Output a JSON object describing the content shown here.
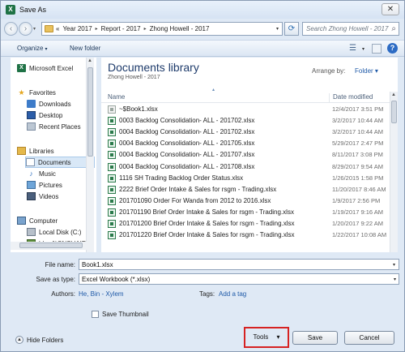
{
  "window": {
    "title": "Save As",
    "close_glyph": "✕"
  },
  "address": {
    "back_glyph": "‹",
    "forward_glyph": "›",
    "overflow": "«",
    "crumbs": [
      "Year 2017",
      "Report - 2017",
      "Zhong Howell - 2017"
    ],
    "separator": "▸",
    "dropdown_glyph": "▾",
    "refresh_glyph": "⟳"
  },
  "search": {
    "placeholder": "Search Zhong Howell - 2017",
    "icon": "search-icon"
  },
  "toolbar": {
    "organize_label": "Organize",
    "new_folder_label": "New folder",
    "help_glyph": "?"
  },
  "nav": {
    "items": [
      {
        "label": "Microsoft Excel",
        "icon": "excel-icon",
        "glyph": "X"
      },
      {
        "label": "Favorites",
        "icon": "star-icon",
        "glyph": "★"
      },
      {
        "label": "Downloads",
        "icon": "downloads-icon",
        "glyph": ""
      },
      {
        "label": "Desktop",
        "icon": "desktop-icon",
        "glyph": ""
      },
      {
        "label": "Recent Places",
        "icon": "recent-places-icon",
        "glyph": ""
      },
      {
        "label": "Libraries",
        "icon": "libraries-icon",
        "glyph": ""
      },
      {
        "label": "Documents",
        "icon": "documents-icon",
        "glyph": ""
      },
      {
        "label": "Music",
        "icon": "music-icon",
        "glyph": "♪"
      },
      {
        "label": "Pictures",
        "icon": "pictures-icon",
        "glyph": ""
      },
      {
        "label": "Videos",
        "icon": "videos-icon",
        "glyph": ""
      },
      {
        "label": "Computer",
        "icon": "computer-icon",
        "glyph": ""
      },
      {
        "label": "Local Disk (C:)",
        "icon": "disk-icon",
        "glyph": ""
      },
      {
        "label": "bhe (\\\\CNSHAIF",
        "icon": "network-drive-icon",
        "glyph": ""
      }
    ],
    "selected": "Documents"
  },
  "library": {
    "title": "Documents library",
    "subtitle": "Zhong Howell - 2017",
    "arrange_label": "Arrange by:",
    "arrange_value": "Folder",
    "arrange_glyph": "▾"
  },
  "columns": {
    "name": "Name",
    "date": "Date modified",
    "sort_glyph": "▴"
  },
  "files": [
    {
      "name": "~$Book1.xlsx",
      "date": "12/4/2017 3:51 PM"
    },
    {
      "name": "0003 Backlog Consolidation- ALL - 201702.xlsx",
      "date": "3/2/2017 10:44 AM"
    },
    {
      "name": "0004 Backlog Consolidation- ALL - 201702.xlsx",
      "date": "3/2/2017 10:44 AM"
    },
    {
      "name": "0004 Backlog Consolidation- ALL - 201705.xlsx",
      "date": "5/29/2017 2:47 PM"
    },
    {
      "name": "0004 Backlog Consolidation- ALL - 201707.xlsx",
      "date": "8/11/2017 3:08 PM"
    },
    {
      "name": "0004 Backlog Consolidation- ALL - 201708.xlsx",
      "date": "8/29/2017 9:54 AM"
    },
    {
      "name": "1116 SH Trading Backlog Order Status.xlsx",
      "date": "1/26/2015 1:58 PM"
    },
    {
      "name": "2222 Brief Order Intake & Sales for rsgm - Trading.xlsx",
      "date": "11/20/2017 8:46 AM"
    },
    {
      "name": "201701090 Order For Wanda from 2012 to 2016.xlsx",
      "date": "1/9/2017 2:56 PM"
    },
    {
      "name": "201701190 Brief Order Intake & Sales for rsgm - Trading.xlsx",
      "date": "1/19/2017 9:16 AM"
    },
    {
      "name": "201701200 Brief Order Intake & Sales for rsgm - Trading.xlsx",
      "date": "1/20/2017 9:22 AM"
    },
    {
      "name": "201701220 Brief Order Intake & Sales for rsgm - Trading.xlsx",
      "date": "1/22/2017 10:08 AM"
    }
  ],
  "form": {
    "file_name_label": "File name:",
    "file_name_value": "Book1.xlsx",
    "save_type_label": "Save as type:",
    "save_type_value": "Excel Workbook (*.xlsx)",
    "authors_label": "Authors:",
    "authors_value": "He, Bin - Xylem",
    "tags_label": "Tags:",
    "tags_value": "Add a tag",
    "thumbnail_label": "Save Thumbnail"
  },
  "footer": {
    "hide_folders_label": "Hide Folders",
    "hide_glyph": "▲",
    "tools_label": "Tools",
    "tools_glyph": "▾",
    "save_label": "Save",
    "cancel_label": "Cancel"
  },
  "colors": {
    "highlight": "#d62222",
    "link": "#1f5aa8",
    "title": "#1e3b6b"
  }
}
